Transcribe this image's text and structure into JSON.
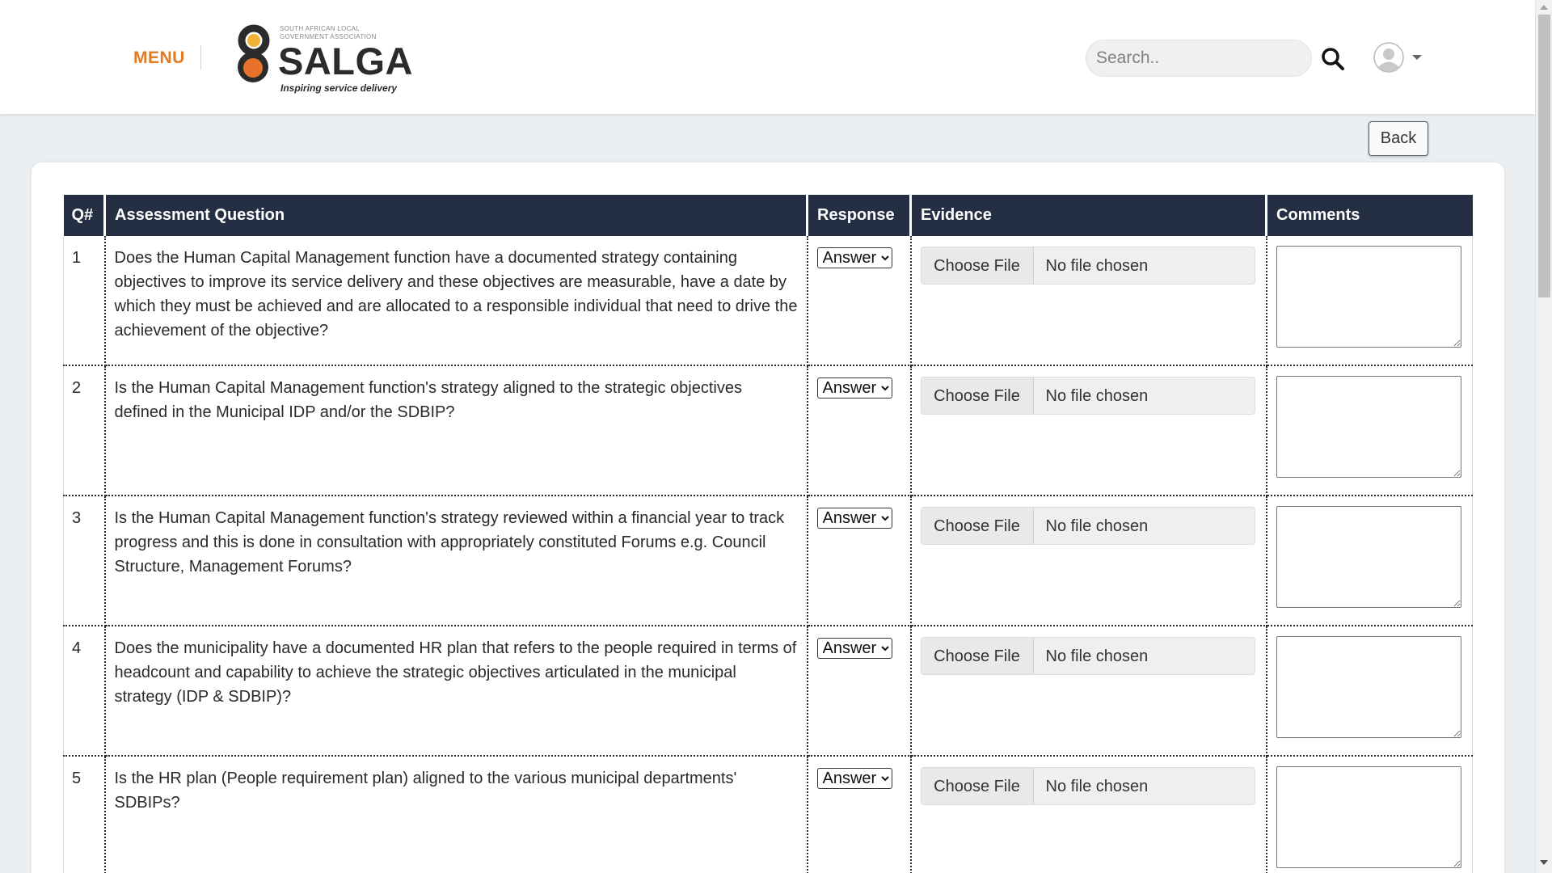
{
  "header": {
    "menu_label": "MENU",
    "logo": {
      "org_line1": "SOUTH AFRICAN LOCAL",
      "org_line2": "GOVERNMENT ASSOCIATION",
      "wordmark": "SALGA",
      "tagline": "Inspiring service delivery",
      "colors": {
        "orange": "#e8722a",
        "yellow": "#f2b134",
        "dark": "#2b2b2b"
      }
    },
    "search": {
      "placeholder": "Search..",
      "value": ""
    },
    "icons": {
      "search": "search-icon",
      "user": "user-avatar-icon",
      "dropdown": "caret-down-icon"
    }
  },
  "back_label": "Back",
  "table": {
    "headers": [
      "Q#",
      "Assessment Question",
      "Response",
      "Evidence",
      "Comments"
    ],
    "header_color": "#242f44",
    "rows": [
      {
        "num": "1",
        "question": "Does the Human Capital Management function have a documented strategy containing objectives to improve its service delivery and these objectives are measurable, have a date by which they must be achieved and are allocated to a responsible individual that need to drive the achievement of the objective?",
        "response": "Answer",
        "file_button": "Choose File",
        "file_status": "No file chosen",
        "comment": ""
      },
      {
        "num": "2",
        "question": "Is the Human Capital Management function's strategy aligned to the strategic objectives defined in the Municipal IDP and/or the SDBIP?",
        "response": "Answer",
        "file_button": "Choose File",
        "file_status": "No file chosen",
        "comment": ""
      },
      {
        "num": "3",
        "question": "Is the Human Capital Management function's strategy reviewed within a financial year to track progress and this is done in consultation with appropriately constituted Forums e.g. Council Structure, Management Forums?",
        "response": "Answer",
        "file_button": "Choose File",
        "file_status": "No file chosen",
        "comment": ""
      },
      {
        "num": "4",
        "question": "Does the municipality have a documented HR plan that refers to the people required in terms of headcount and capability to achieve the strategic objectives articulated in the municipal strategy (IDP & SDBIP)?",
        "response": "Answer",
        "file_button": "Choose File",
        "file_status": "No file chosen",
        "comment": ""
      },
      {
        "num": "5",
        "question": "Is the HR plan (People requirement plan) aligned to the various municipal departments' SDBIPs?",
        "response": "Answer",
        "file_button": "Choose File",
        "file_status": "No file chosen",
        "comment": ""
      }
    ]
  }
}
